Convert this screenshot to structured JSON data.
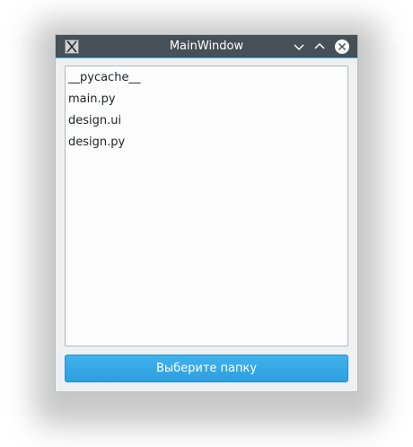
{
  "window": {
    "title": "MainWindow",
    "app_icon": "x11-app-icon",
    "controls": {
      "minimize_icon": "chevron-down-icon",
      "maximize_icon": "chevron-up-icon",
      "close_icon": "close-circle-icon"
    }
  },
  "file_list": {
    "items": [
      {
        "label": "__pycache__"
      },
      {
        "label": "main.py"
      },
      {
        "label": "design.ui"
      },
      {
        "label": "design.py"
      }
    ]
  },
  "choose_folder_button": {
    "label": "Выберите папку"
  },
  "colors": {
    "titlebar": "#475057",
    "accent": "#3daee9",
    "window_bg": "#eff0f1",
    "list_bg": "#fcfcfc",
    "button_bg": "#3daee9",
    "text": "#232627"
  }
}
